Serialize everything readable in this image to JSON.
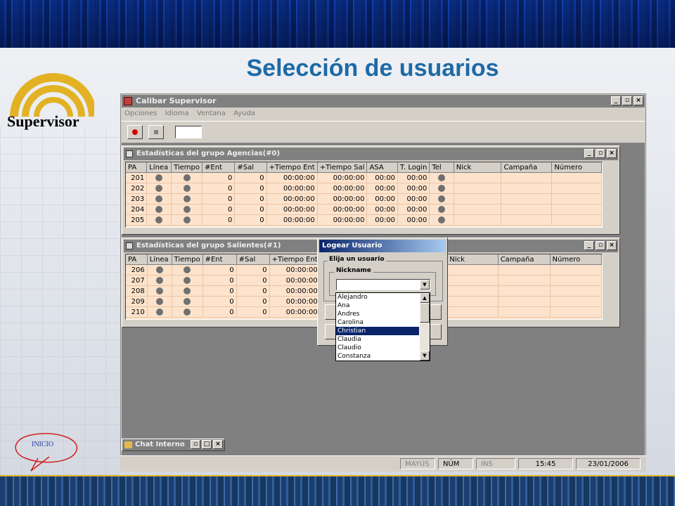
{
  "slide": {
    "title": "Selección de usuarios",
    "logo_text": "Supervisor",
    "home_link": "INICIO"
  },
  "app": {
    "window_title": "Calibar Supervisor",
    "menu": [
      "Opciones",
      "Idioma",
      "Ventana",
      "Ayuda"
    ],
    "toolbar": {
      "record_icon": "record-icon",
      "stop_icon": "stop-icon",
      "field_value": ""
    }
  },
  "columns": [
    "PA",
    "Línea",
    "Tiempo",
    "#Ent",
    "#Sal",
    "+Tiempo Ent",
    "+Tiempo Sal",
    "ASA",
    "T. Login",
    "Tel",
    "Nick",
    "Campaña",
    "Número"
  ],
  "group1": {
    "title": "Estadísticas del grupo Agencias(#0)",
    "rows": [
      {
        "pa": "201",
        "ent": "0",
        "sal": "0",
        "tent": "00:00:00",
        "tsal": "00:00:00",
        "asa": "00:00",
        "login": "00:00",
        "nick": "",
        "campana": "",
        "numero": ""
      },
      {
        "pa": "202",
        "ent": "0",
        "sal": "0",
        "tent": "00:00:00",
        "tsal": "00:00:00",
        "asa": "00:00",
        "login": "00:00",
        "nick": "",
        "campana": "",
        "numero": ""
      },
      {
        "pa": "203",
        "ent": "0",
        "sal": "0",
        "tent": "00:00:00",
        "tsal": "00:00:00",
        "asa": "00:00",
        "login": "00:00",
        "nick": "",
        "campana": "",
        "numero": ""
      },
      {
        "pa": "204",
        "ent": "0",
        "sal": "0",
        "tent": "00:00:00",
        "tsal": "00:00:00",
        "asa": "00:00",
        "login": "00:00",
        "nick": "",
        "campana": "",
        "numero": ""
      },
      {
        "pa": "205",
        "ent": "0",
        "sal": "0",
        "tent": "00:00:00",
        "tsal": "00:00:00",
        "asa": "00:00",
        "login": "00:00",
        "nick": "",
        "campana": "",
        "numero": ""
      }
    ]
  },
  "group2": {
    "title": "Estadísticas del grupo Salientes(#1)",
    "rows": [
      {
        "pa": "206",
        "ent": "0",
        "sal": "0",
        "tent": "00:00:00"
      },
      {
        "pa": "207",
        "ent": "0",
        "sal": "0",
        "tent": "00:00:00"
      },
      {
        "pa": "208",
        "ent": "0",
        "sal": "0",
        "tent": "00:00:00"
      },
      {
        "pa": "209",
        "ent": "0",
        "sal": "0",
        "tent": "00:00:00"
      },
      {
        "pa": "210",
        "ent": "0",
        "sal": "0",
        "tent": "00:00:00"
      }
    ]
  },
  "dialog": {
    "title": "Logear Usuario",
    "group_label": "Elija un usuario",
    "field_label": "Nickname",
    "field_value": "",
    "options": [
      "Alejandro",
      "Ana",
      "Andres",
      "Carolina",
      "Christian",
      "Claudia",
      "Claudio",
      "Constanza"
    ],
    "selected": "Christian"
  },
  "chat": {
    "title": "Chat Interno"
  },
  "statusbar": {
    "caps": "MAYÚS",
    "num": "NÚM",
    "ins": "INS",
    "time": "15:45",
    "date": "23/01/2006"
  },
  "colors": {
    "title_blue": "#1e6aa6",
    "grid_bg": "#fde3cc",
    "selection": "#0a246a",
    "logo_yellow": "#e2b224"
  }
}
